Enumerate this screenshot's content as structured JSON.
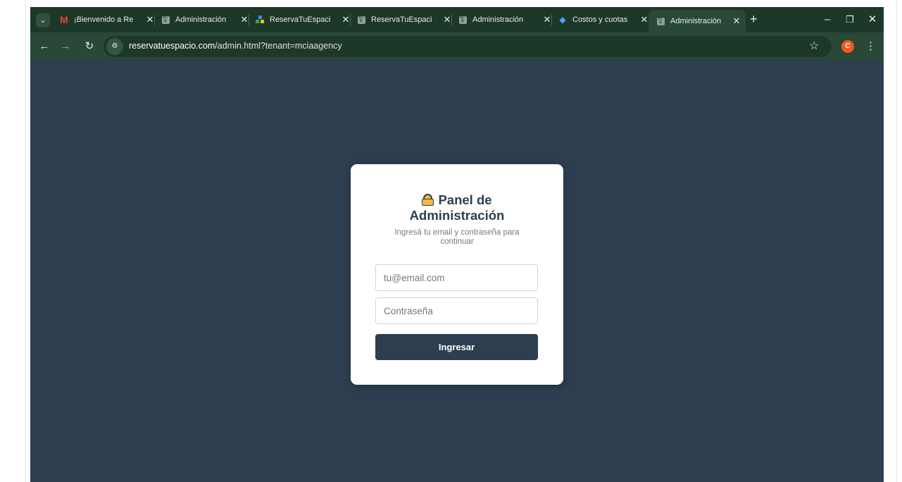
{
  "browser": {
    "tabs": [
      {
        "title": "¡Bienvenido a Re",
        "icon": "gmail-icon"
      },
      {
        "title": "Administración",
        "icon": "rt-icon"
      },
      {
        "title": "ReservaTuEspaci",
        "icon": "grid-icon"
      },
      {
        "title": "ReservaTuEspaci",
        "icon": "rt-icon"
      },
      {
        "title": "Administración",
        "icon": "rt-icon"
      },
      {
        "title": "Costos y cuotas",
        "icon": "dropbox-icon"
      },
      {
        "title": "Administración",
        "icon": "rt-icon",
        "active": true
      }
    ],
    "tab_close": "✕",
    "favicon_rt": "RT E",
    "favicon_m": "M",
    "new_tab": "+",
    "url_domain": "reservatuespacio.com",
    "url_path": "/admin.html?tenant=mciaagency",
    "profile_initial": "C",
    "colors": {
      "frame": "#1c3828",
      "toolbar": "#2a4837",
      "page": "#2e3e50"
    }
  },
  "login": {
    "title_line1": "Panel de",
    "title_line2": "Administración",
    "subtitle_line1": "Ingresá tu email y contraseña para",
    "subtitle_line2": "continuar",
    "email_placeholder": "tu@email.com",
    "password_placeholder": "Contraseña",
    "submit_label": "Ingresar",
    "colors": {
      "primary": "#2c3e50",
      "card": "#ffffff"
    }
  }
}
